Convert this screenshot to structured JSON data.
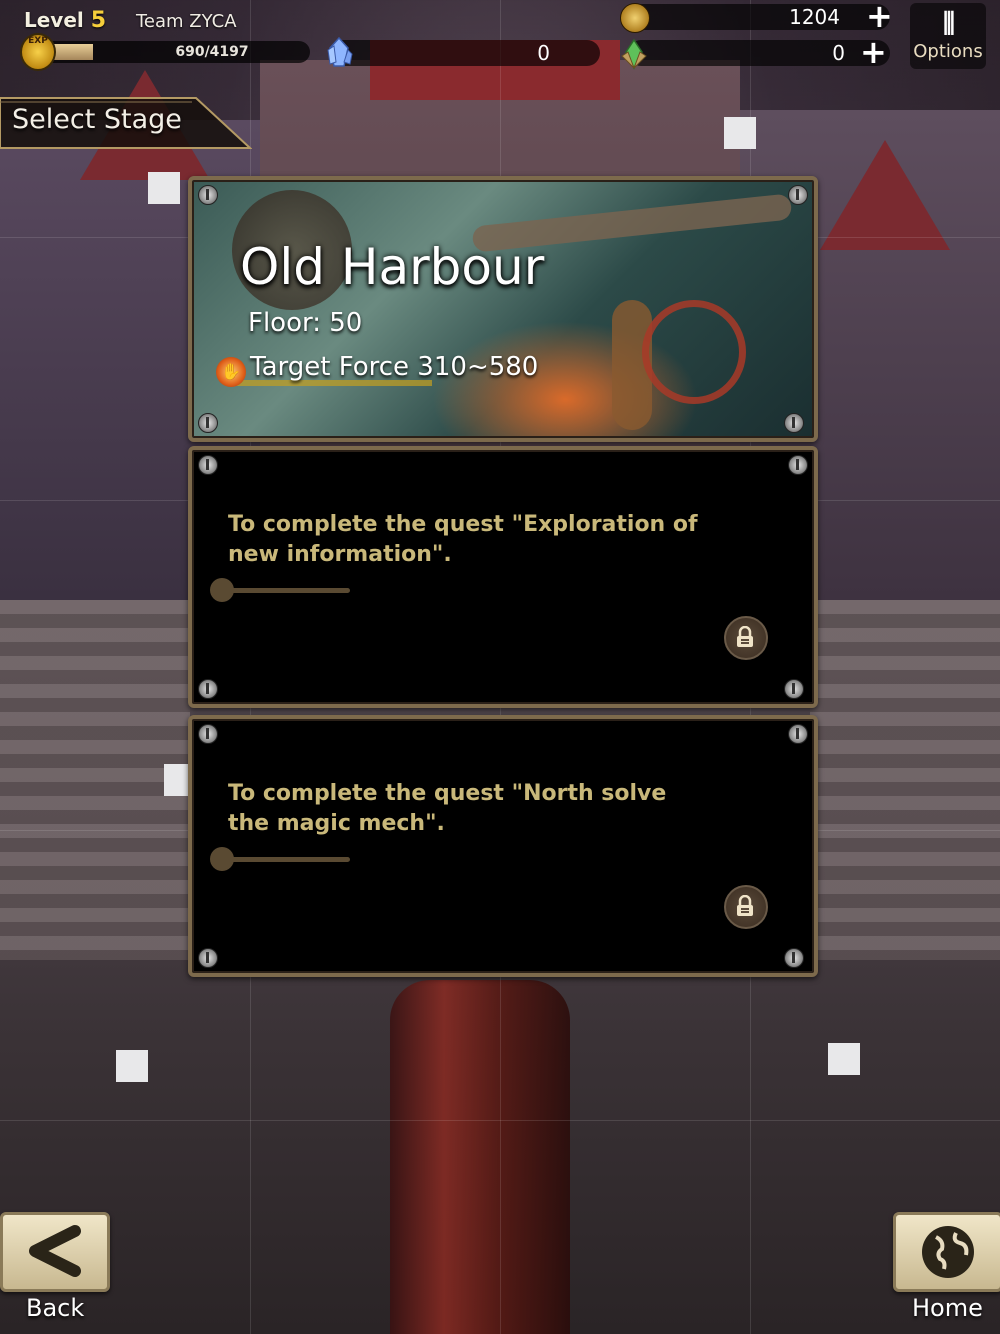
{
  "player": {
    "level_label": "Level",
    "level_value": "5",
    "exp_badge": "EXP",
    "exp_text": "690/4197",
    "exp_fraction": 0.16,
    "team_name": "Team ZYCA"
  },
  "resources": {
    "gold": "1204",
    "crystal": "0",
    "gem": "0",
    "plus_glyph": "+"
  },
  "options": {
    "icon_glyph": "⫼",
    "label": "Options"
  },
  "banner": {
    "title": "Select Stage"
  },
  "stage": {
    "name": "Old Harbour",
    "floor": "Floor: 50",
    "target_force": "Target Force 310~580"
  },
  "quests": [
    {
      "text": "To complete the quest \"Exploration of new information\".",
      "progress": 0.0,
      "locked": true
    },
    {
      "text": "To complete the quest \"North solve the magic mech\".",
      "progress": 0.0,
      "locked": true
    }
  ],
  "nav": {
    "back_label": "Back",
    "home_label": "Home"
  },
  "colors": {
    "accent_gold": "#f6cf3b",
    "quest_text": "#c9b87a",
    "panel_border": "#7d6a4c"
  }
}
